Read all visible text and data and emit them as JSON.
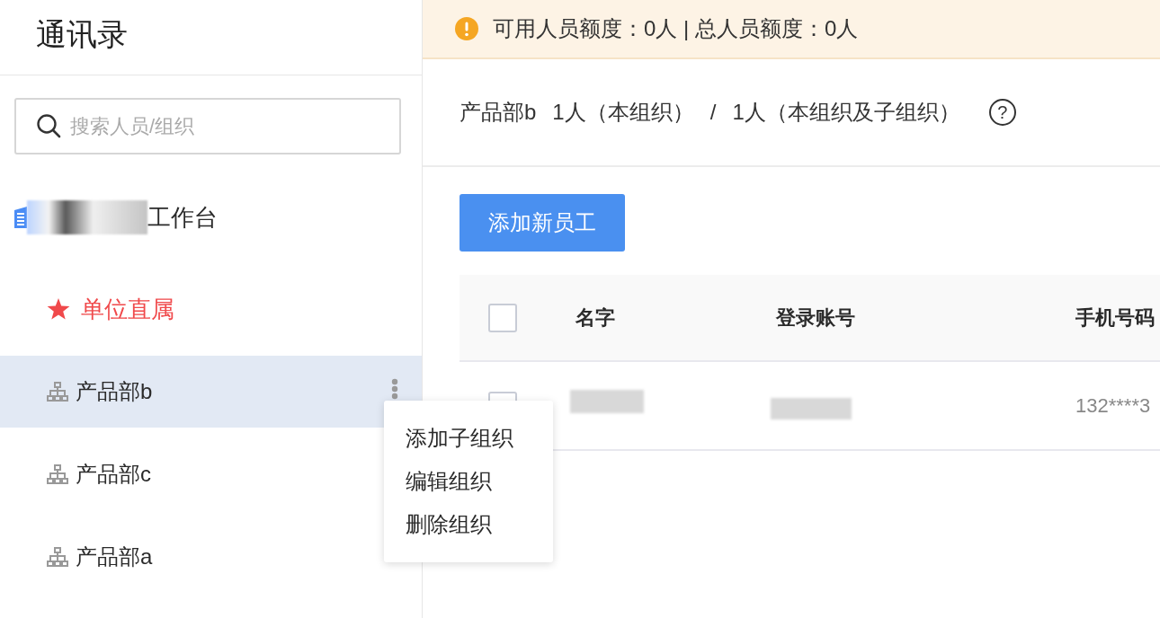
{
  "sidebar": {
    "title": "通讯录",
    "search": {
      "placeholder": "搜索人员/组织"
    },
    "tree": [
      {
        "kind": "workspace",
        "redacted_prefix": true,
        "label": "工作台",
        "selected": false
      },
      {
        "kind": "pinned",
        "label": "单位直属",
        "selected": false
      },
      {
        "kind": "org",
        "label": "产品部b",
        "selected": true,
        "has_more": true
      },
      {
        "kind": "org",
        "label": "产品部c",
        "selected": false
      },
      {
        "kind": "org",
        "label": "产品部a",
        "selected": false
      }
    ],
    "context_menu": [
      "添加子组织",
      "编辑组织",
      "删除组织"
    ]
  },
  "banner": {
    "text": "可用人员额度：0人 | 总人员额度：0人"
  },
  "summary": {
    "department": "产品部b",
    "own_count": "1人（本组织）",
    "separator": "/",
    "total_count": "1人（本组织及子组织）",
    "help": "?"
  },
  "add_button": "添加新员工",
  "table": {
    "select_all": {
      "checked": false
    },
    "columns": [
      "名字",
      "登录账号",
      "手机号码"
    ],
    "rows": [
      {
        "checked": false,
        "cells": [
          {
            "kind": "redacted"
          },
          {
            "kind": "redacted"
          },
          {
            "kind": "text",
            "text": "132****3"
          }
        ]
      }
    ]
  }
}
